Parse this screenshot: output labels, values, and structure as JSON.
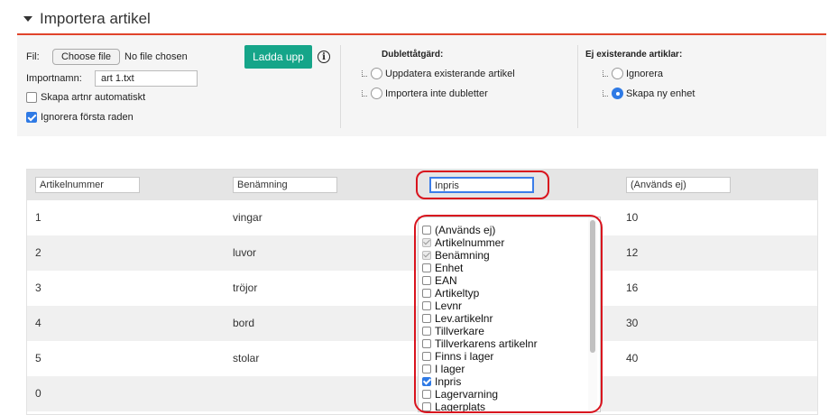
{
  "section": {
    "title": "Importera artikel"
  },
  "file": {
    "label": "Fil:",
    "choose_button": "Choose file",
    "status": "No file chosen",
    "importname_label": "Importnamn:",
    "importname_value": "art 1.txt",
    "auto_artnr_label": "Skapa artnr automatiskt",
    "auto_artnr_checked": false,
    "ignore_first_label": "Ignorera första raden",
    "ignore_first_checked": true
  },
  "upload_button": "Ladda upp",
  "duplicates": {
    "title": "Dublettåtgärd:",
    "options": [
      {
        "label": "Uppdatera existerande artikel",
        "selected": false
      },
      {
        "label": "Importera inte dubletter",
        "selected": false
      }
    ]
  },
  "non_existing": {
    "title": "Ej existerande artiklar:",
    "options": [
      {
        "label": "Ignorera",
        "selected": false
      },
      {
        "label": "Skapa ny enhet",
        "selected": true
      }
    ]
  },
  "grid": {
    "columns": [
      "Artikelnummer",
      "Benämning",
      "Inpris",
      "(Används ej)"
    ],
    "rows": [
      [
        "1",
        "vingar",
        "",
        "10"
      ],
      [
        "2",
        "luvor",
        "",
        "12"
      ],
      [
        "3",
        "tröjor",
        "",
        "16"
      ],
      [
        "4",
        "bord",
        "",
        "30"
      ],
      [
        "5",
        "stolar",
        "",
        "40"
      ],
      [
        "0",
        "",
        "",
        ""
      ]
    ]
  },
  "dropdown": {
    "items": [
      {
        "label": "(Används ej)",
        "state": "none"
      },
      {
        "label": "Artikelnummer",
        "state": "used"
      },
      {
        "label": "Benämning",
        "state": "used"
      },
      {
        "label": "Enhet",
        "state": "none"
      },
      {
        "label": "EAN",
        "state": "none"
      },
      {
        "label": "Artikeltyp",
        "state": "none"
      },
      {
        "label": "Levnr",
        "state": "none"
      },
      {
        "label": "Lev.artikelnr",
        "state": "none"
      },
      {
        "label": "Tillverkare",
        "state": "none"
      },
      {
        "label": "Tillverkarens artikelnr",
        "state": "none"
      },
      {
        "label": "Finns i lager",
        "state": "none"
      },
      {
        "label": "I lager",
        "state": "none"
      },
      {
        "label": "Inpris",
        "state": "checked"
      },
      {
        "label": "Lagervarning",
        "state": "none"
      },
      {
        "label": "Lagerplats",
        "state": "none"
      }
    ]
  },
  "colors": {
    "accent_rule": "#e0442b",
    "upload_button": "#15a589",
    "highlight_oval": "#d9141e",
    "check_blue": "#2f7ae5"
  }
}
